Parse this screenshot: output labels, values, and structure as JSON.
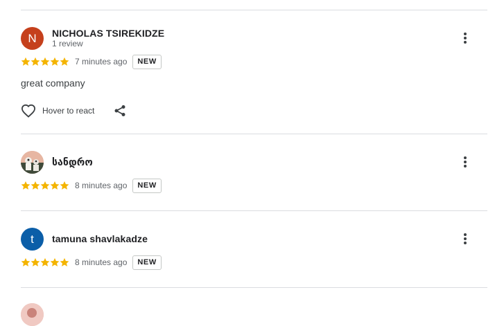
{
  "colors": {
    "star": "#f4b400",
    "avatar_n": "#c5401c",
    "avatar_t": "#0b5ea8",
    "divider": "#dadce0"
  },
  "reviews": [
    {
      "avatar_letter": "N",
      "name": "NICHOLAS TSIREKIDZE",
      "review_count": "1 review",
      "rating": 5,
      "time": "7 minutes ago",
      "badge": "NEW",
      "text": "great company",
      "react_label": "Hover to react"
    },
    {
      "avatar_letter": "",
      "name": "სანდრო",
      "rating": 5,
      "time": "8 minutes ago",
      "badge": "NEW"
    },
    {
      "avatar_letter": "t",
      "name": "tamuna shavlakadze",
      "rating": 5,
      "time": "8 minutes ago",
      "badge": "NEW"
    }
  ],
  "icons": {
    "more": "more-vert-icon",
    "heart": "heart-outline-icon",
    "share": "share-icon",
    "star": "star-icon"
  }
}
